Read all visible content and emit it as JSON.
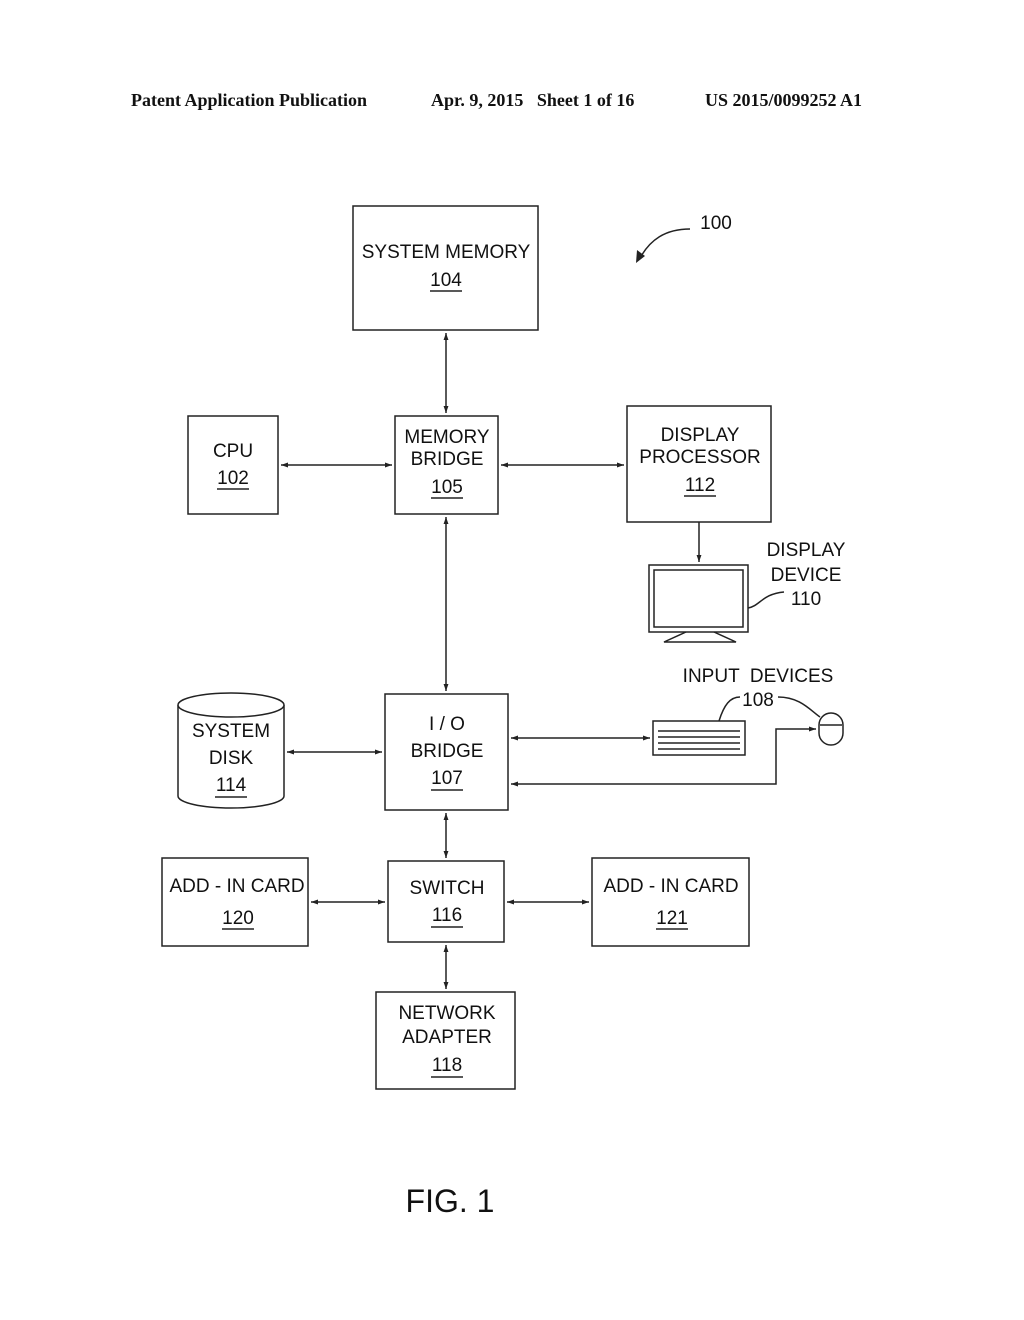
{
  "header": {
    "publication": "Patent Application Publication",
    "date_sheet": "Apr. 9, 2015   Sheet 1 of 16",
    "number": "US 2015/0099252 A1"
  },
  "diagram": {
    "ref_main": "100",
    "blocks": {
      "system_memory": {
        "lines": [
          "SYSTEM MEMORY"
        ],
        "ref": "104"
      },
      "cpu": {
        "lines": [
          "CPU"
        ],
        "ref": "102"
      },
      "memory_bridge": {
        "lines": [
          "MEMORY",
          "BRIDGE"
        ],
        "ref": "105"
      },
      "display_processor": {
        "lines": [
          "DISPLAY",
          "PROCESSOR"
        ],
        "ref": "112"
      },
      "display_device": {
        "lines": [
          "DISPLAY",
          "DEVICE"
        ],
        "ref": "110"
      },
      "input_devices": {
        "lines": [
          "INPUT  DEVICES"
        ],
        "ref": "108"
      },
      "system_disk": {
        "lines": [
          "SYSTEM",
          "DISK"
        ],
        "ref": "114"
      },
      "io_bridge": {
        "lines": [
          "I / O",
          "BRIDGE"
        ],
        "ref": "107"
      },
      "add_in_card_left": {
        "lines": [
          "ADD - IN CARD"
        ],
        "ref": "120"
      },
      "switch": {
        "lines": [
          "SWITCH"
        ],
        "ref": "116"
      },
      "add_in_card_right": {
        "lines": [
          "ADD - IN CARD"
        ],
        "ref": "121"
      },
      "network_adapter": {
        "lines": [
          "NETWORK",
          "ADAPTER"
        ],
        "ref": "118"
      }
    },
    "figure_label": "FIG. 1"
  }
}
